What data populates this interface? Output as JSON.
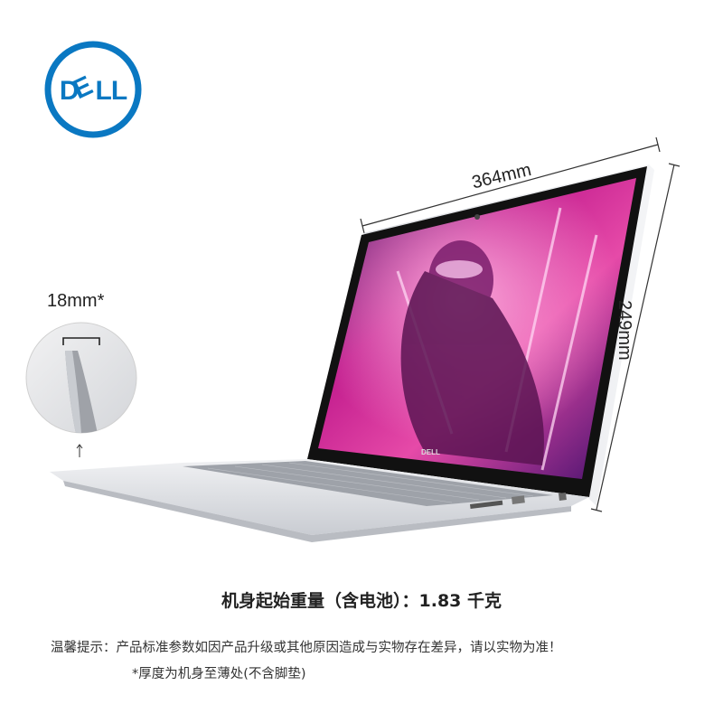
{
  "brand": {
    "logo_text": "DELL",
    "logo_color": "#0a78c2"
  },
  "dimensions": {
    "width_label": "364mm",
    "height_label": "249mm",
    "thickness_label": "18mm*"
  },
  "screen_badge": "DELL",
  "weight_text": "机身起始重量（含电池）：1.83 千克",
  "notice_text": "温馨提示：产品标准参数如因产品升级或其他原因造成与实物存在差异，请以实物为准！",
  "footnote_text": "*厚度为机身至薄处(不含脚垫)",
  "colors": {
    "screen_pink": "#e0249a",
    "screen_purple": "#3a0f6e",
    "chassis_silver": "#e2e4e8"
  }
}
